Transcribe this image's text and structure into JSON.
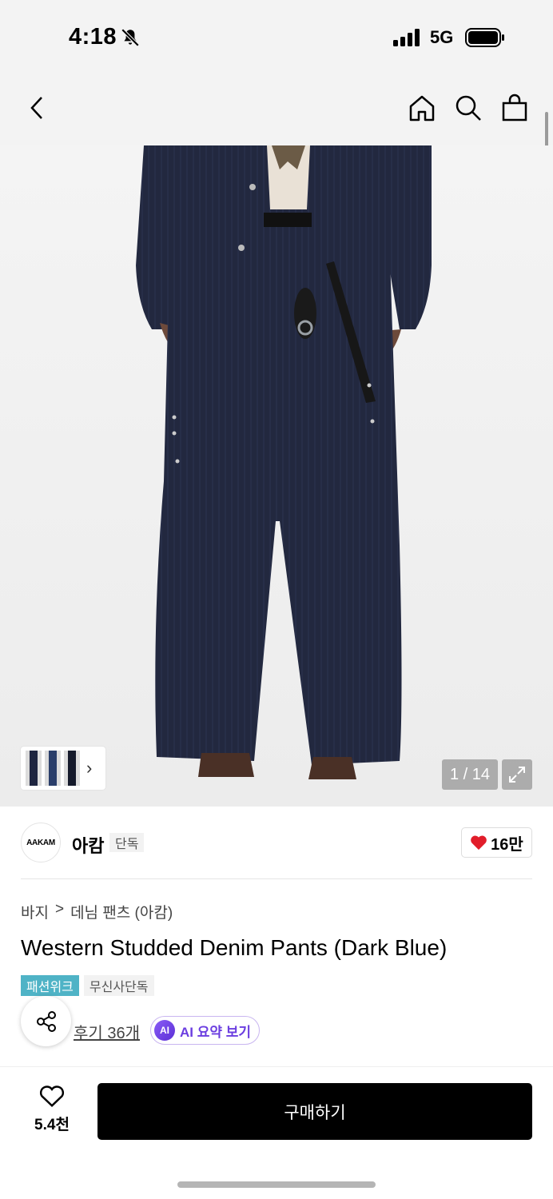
{
  "status": {
    "time": "4:18",
    "network": "5G"
  },
  "gallery": {
    "counter": "1 / 14"
  },
  "brand": {
    "logo_text": "AAKAM",
    "name": "아캄",
    "badge": "단독",
    "likes": "16만"
  },
  "breadcrumb": {
    "category": "바지",
    "separator": ">",
    "subcategory": "데님 팬츠 (아캄)"
  },
  "product": {
    "title": "Western Studded Denim Pants (Dark Blue)",
    "tags": [
      "패션위크",
      "무신사단독"
    ],
    "reviews": "후기 36개",
    "ai_summary": "AI 요약 보기",
    "ai_badge": "AI"
  },
  "footer": {
    "wish_count": "5.4천",
    "buy_label": "구매하기"
  },
  "colors": {
    "tag_week": "#4fb3c6",
    "ai_purple": "#6b3ee0",
    "heart_red": "#e11d2a"
  }
}
